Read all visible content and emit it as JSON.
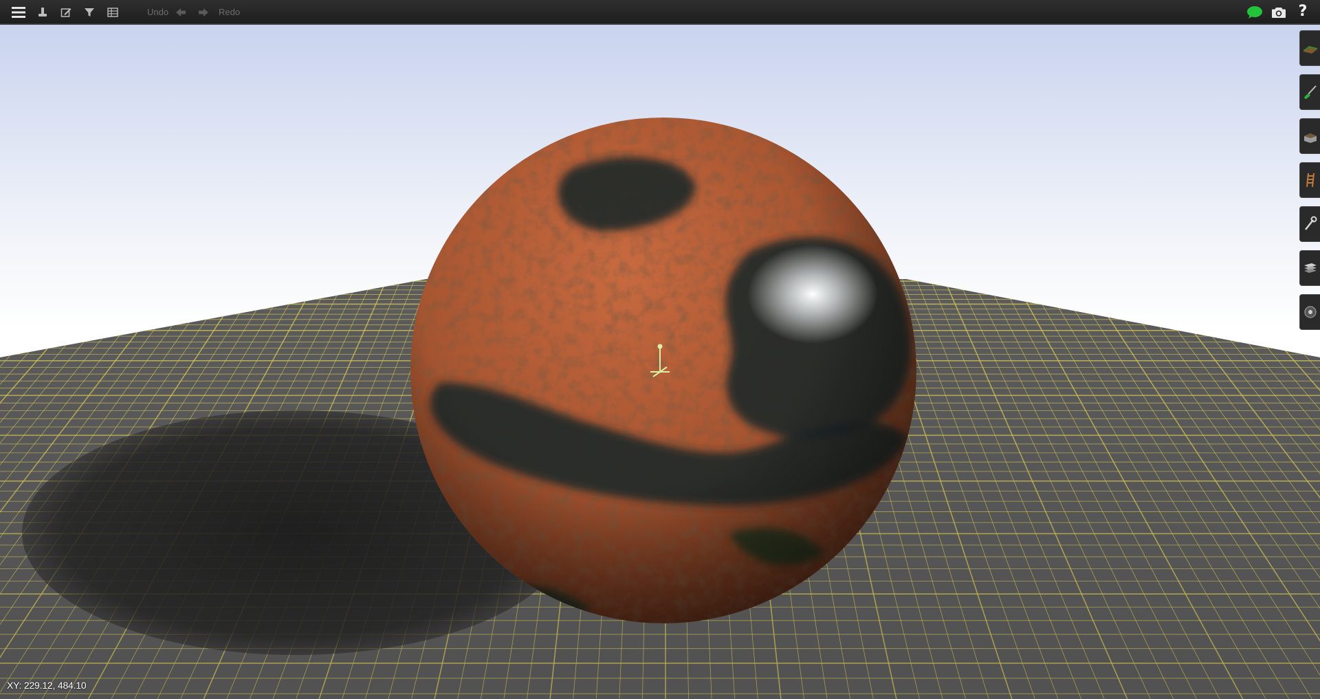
{
  "toolbar": {
    "undo_label": "Undo",
    "redo_label": "Redo",
    "icons": [
      "menu-icon",
      "person-icon",
      "edit-icon",
      "filter-icon",
      "table-icon",
      "undo-arrow-icon",
      "redo-arrow-icon",
      "chat-icon",
      "camera-icon",
      "help-icon"
    ],
    "help_glyph": "?"
  },
  "side_palette": {
    "icons": [
      "terrain-tool-icon",
      "paint-brush-tool-icon",
      "building-tool-icon",
      "ladder-tool-icon",
      "wrench-tool-icon",
      "layers-tool-icon",
      "light-tool-icon"
    ]
  },
  "status": {
    "coordinates": "XY: 229.12, 484.10"
  },
  "colors": {
    "toolbar_bg": "#262626",
    "accent_green": "#22c43a",
    "grid_line": "#d8c85a",
    "floor": "#5c5c5c",
    "rust": "#b45a32"
  }
}
